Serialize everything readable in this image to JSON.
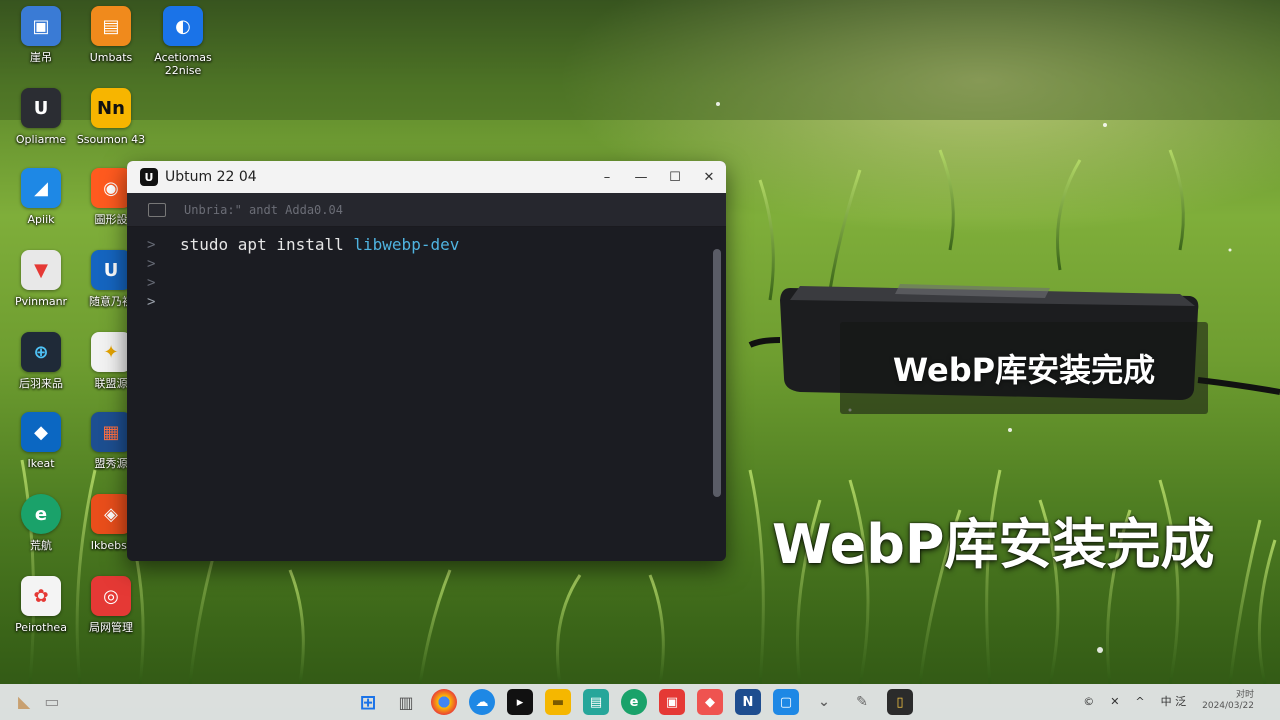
{
  "desktop": {
    "icons": [
      {
        "label": "崖吊",
        "glyph": "▣",
        "color": "#3a7bd5"
      },
      {
        "label": "Umbats",
        "glyph": "▤",
        "color": "#f08a1c"
      },
      {
        "label": "Acetiomas 22nise",
        "glyph": "◐",
        "color": "#1a73e8"
      },
      {
        "label": "Opliarme",
        "glyph": "U",
        "color": "#2b2d33"
      },
      {
        "label": "Ssoumon 43",
        "glyph": "Nn",
        "color": "#f7b500"
      },
      {
        "label": "Apiik",
        "glyph": "◢",
        "color": "#1e88e5"
      },
      {
        "label": "圖形設",
        "glyph": "◉",
        "color": "#ff5a1f"
      },
      {
        "label": "Pvinmanr",
        "glyph": "▼",
        "color": "#e8e8e8"
      },
      {
        "label": "随意乃初",
        "glyph": "U",
        "color": "#1565c0"
      },
      {
        "label": "后羽来品",
        "glyph": "⊕",
        "color": "#1f2a38"
      },
      {
        "label": "联盟源",
        "glyph": "✦",
        "color": "#f2f2f2"
      },
      {
        "label": "Ikeat",
        "glyph": "◆",
        "color": "#0b67c2"
      },
      {
        "label": "盟秀源",
        "glyph": "▦",
        "color": "#1d4f91"
      },
      {
        "label": "荒航",
        "glyph": "e",
        "color": "#1aa26a"
      },
      {
        "label": "Ikbebst",
        "glyph": "◈",
        "color": "#e94e1b"
      },
      {
        "label": "Peirothea",
        "glyph": "✿",
        "color": "#f4f4f4"
      },
      {
        "label": "局网管理",
        "glyph": "◎",
        "color": "#e53935"
      }
    ]
  },
  "terminal": {
    "title": "Ubtum 22 04",
    "icon": "ubuntu-logo",
    "tab_text": "Unbria:\" andt Adda0.04",
    "prompts": [
      ">",
      ">",
      ">",
      ">"
    ],
    "command_plain": "studo apt install ",
    "command_highlight": "libwebp-dev",
    "highlight_color": "#4fb3e0",
    "controls": {
      "minimize": "–",
      "minimize2": "—",
      "maximize": "☐",
      "close": "✕"
    }
  },
  "captions": {
    "box_text": "WebP库安装完成",
    "large_text": "WebP库安装完成"
  },
  "taskbar": {
    "clock_top": "对时",
    "clock_bottom": "2024/03/22",
    "tray_labels": [
      "©",
      "✕",
      "^",
      "中 泛"
    ]
  }
}
